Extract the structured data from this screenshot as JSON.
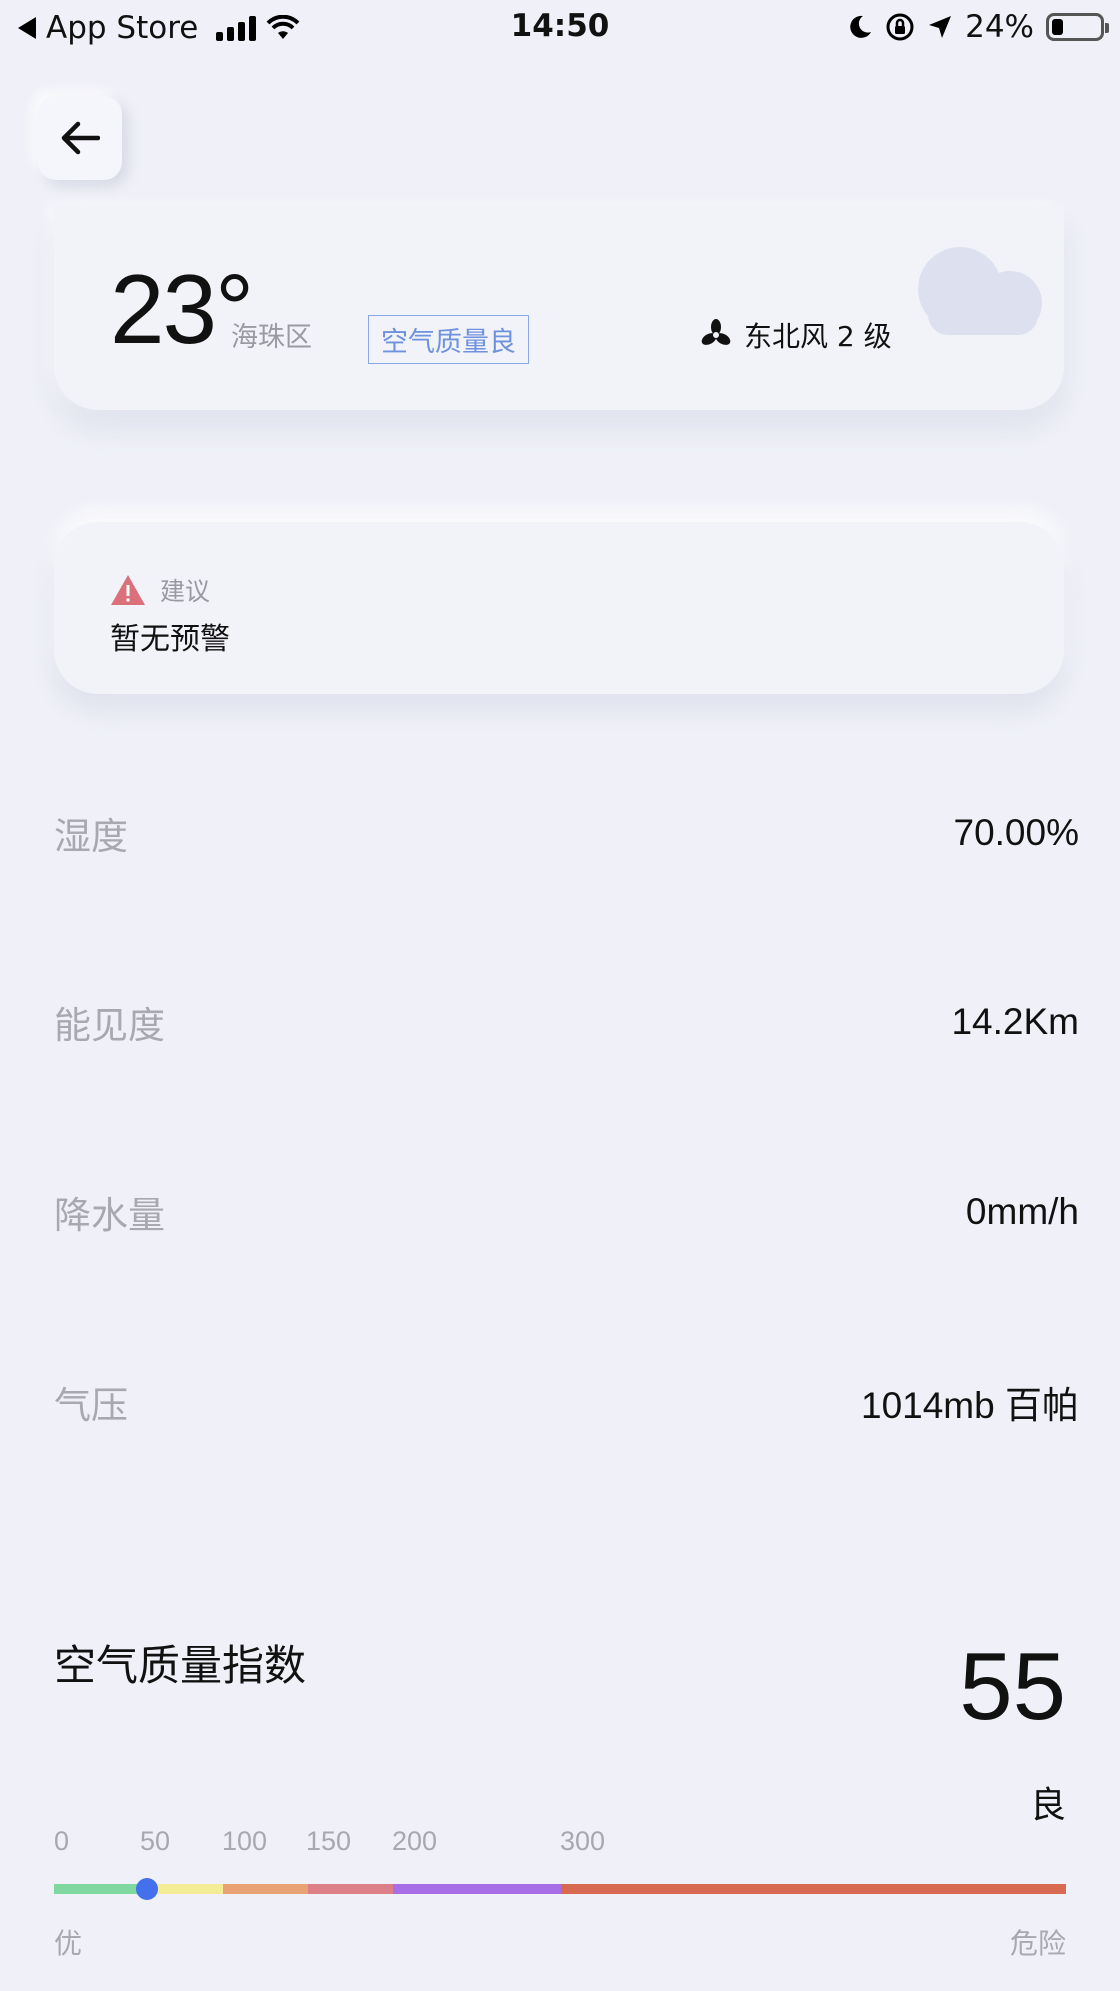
{
  "status_bar": {
    "back_app": "App Store",
    "time": "14:50",
    "battery_text": "24%",
    "battery_level": 0.24
  },
  "weather": {
    "temperature": "23°",
    "district": "海珠区",
    "air_quality_tag": "空气质量良",
    "wind": "东北风 2 级",
    "cloud_icon": "cloud-icon"
  },
  "advice": {
    "label": "建议",
    "text": "暂无预警",
    "icon": "warning-icon"
  },
  "details": [
    {
      "label": "湿度",
      "value": "70.00%"
    },
    {
      "label": "能见度",
      "value": "14.2Km"
    },
    {
      "label": "降水量",
      "value": "0mm/h"
    },
    {
      "label": "气压",
      "value": "1014mb 百帕"
    }
  ],
  "aqi": {
    "title": "空气质量指数",
    "value": "55",
    "level": "良",
    "scale_ticks": [
      "0",
      "50",
      "100",
      "150",
      "200",
      "300"
    ],
    "min_label": "优",
    "max_label": "危险",
    "colors": [
      "#7ed8a0",
      "#f5ec97",
      "#e8a273",
      "#dc7f86",
      "#a76ee6",
      "#d96a52"
    ]
  }
}
